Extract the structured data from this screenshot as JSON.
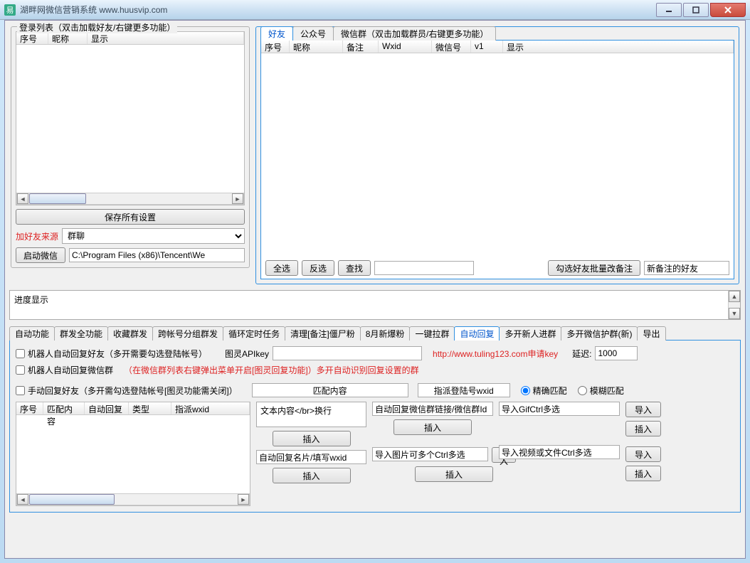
{
  "window": {
    "title": "湖畔网微信营销系统 www.huusvip.com",
    "app_icon_text": "易"
  },
  "left": {
    "legend": "登录列表（双击加载好友/右键更多功能）",
    "cols": {
      "seq": "序号",
      "nick": "昵称",
      "disp": "显示"
    },
    "save_btn": "保存所有设置",
    "add_src_label": "加好友来源",
    "add_src_value": "群聊",
    "start_btn": "启动微信",
    "path_value": "C:\\Program Files (x86)\\Tencent\\We"
  },
  "right": {
    "tabs": {
      "friends": "好友",
      "public": "公众号",
      "groups": "微信群（双击加载群员/右键更多功能）"
    },
    "cols": {
      "seq": "序号",
      "nick": "昵称",
      "remark": "备注",
      "wxid": "Wxid",
      "wechat": "微信号",
      "v1": "v1",
      "disp": "显示"
    },
    "btn_all": "全选",
    "btn_inv": "反选",
    "btn_find": "查找",
    "btn_batch": "勾选好友批量改备注",
    "new_remark": "新备注的好友"
  },
  "progress_label": "进度显示",
  "lower_tabs": {
    "t1": "自动功能",
    "t2": "群发全功能",
    "t3": "收藏群发",
    "t4": "跨帐号分组群发",
    "t5": "循环定时任务",
    "t6": "清理[备注]僵尸粉",
    "t7": "8月新爆粉",
    "t8": "一键拉群",
    "t9": "自动回复",
    "t10": "多开新人进群",
    "t11": "多开微信护群(新)",
    "t12": "导出"
  },
  "auto": {
    "cb1": "机器人自动回复好友（多开需要勾选登陆帐号）",
    "api_label": "图灵APIkey",
    "api_link": "http://www.tuling123.com申请key",
    "delay_label": "延迟:",
    "delay_value": "1000",
    "cb2": "机器人自动回复微信群",
    "cb2_note": "（在微信群列表右键弹出菜单开启[图灵回复功能]）多开自动识别回复设置的群",
    "cb3": "手动回复好友（多开需勾选登陆帐号[图灵功能需关闭]）",
    "match_label": "匹配内容",
    "assign_label": "指派登陆号wxid",
    "radio_exact": "精确匹配",
    "radio_fuzzy": "模糊匹配",
    "table_cols": {
      "seq": "序号",
      "match": "匹配内容",
      "auto": "自动回复",
      "type": "类型",
      "assign": "指派wxid"
    },
    "txt1": "文本内容</br>换行",
    "btn_insert": "插入",
    "txt2": "自动回复名片/填写wxid",
    "txt3": "自动回复微信群链接/微信群Id",
    "txt4": "导入图片可多个Ctrl多选",
    "btn_import": "导入",
    "txt5": "导入GifCtrl多选",
    "txt6": "导入视频或文件Ctrl多选"
  }
}
